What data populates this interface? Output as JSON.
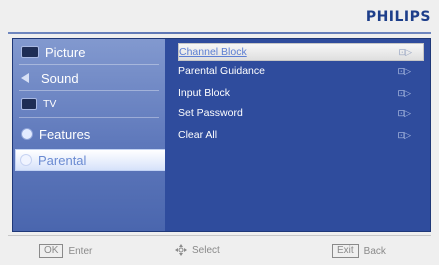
{
  "brand": "PHILIPS",
  "sidebar": {
    "items": [
      {
        "label": "Picture",
        "icon": "picture-icon",
        "selected": false
      },
      {
        "label": "Sound",
        "icon": "speaker-icon",
        "selected": false
      },
      {
        "label": "TV",
        "icon": "tv-icon",
        "selected": false
      },
      {
        "label": "Features",
        "icon": "features-icon",
        "selected": false
      },
      {
        "label": "Parental",
        "icon": "parental-icon",
        "selected": true
      }
    ]
  },
  "menu": {
    "items": [
      {
        "label": "Channel Block",
        "arrow": "⊡▷",
        "selected": true
      },
      {
        "label": "Parental Guidance",
        "arrow": "⊡▷",
        "selected": false
      },
      {
        "label": "Input Block",
        "arrow": "⊡▷",
        "selected": false
      },
      {
        "label": "Set Password",
        "arrow": "⊡▷",
        "selected": false
      },
      {
        "label": "Clear All",
        "arrow": "⊡▷",
        "selected": false
      }
    ]
  },
  "footer": {
    "ok_key": "OK",
    "ok_label": "Enter",
    "select_label": "Select",
    "exit_key": "Exit",
    "exit_label": "Back"
  }
}
